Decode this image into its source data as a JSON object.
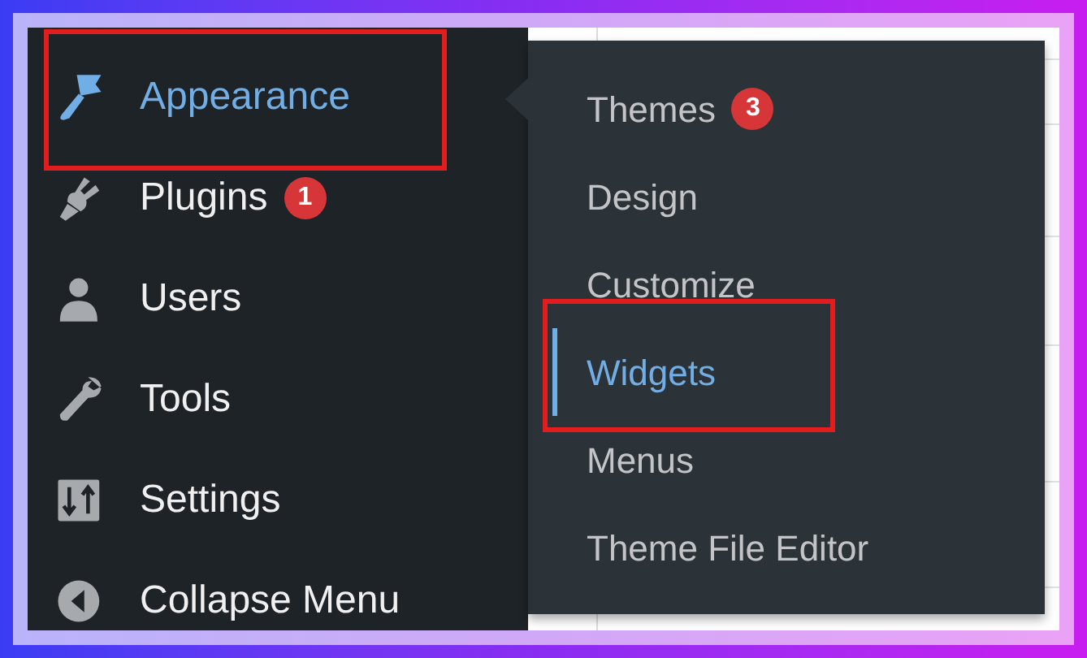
{
  "menu": {
    "items": [
      {
        "label": "Appearance",
        "kind": "brush",
        "current": true,
        "highlighted": true
      },
      {
        "label": "Plugins",
        "kind": "plug",
        "badge": "1",
        "current": false,
        "highlighted": false
      },
      {
        "label": "Users",
        "kind": "user",
        "current": false,
        "highlighted": false
      },
      {
        "label": "Tools",
        "kind": "wrench",
        "current": false,
        "highlighted": false
      },
      {
        "label": "Settings",
        "kind": "sliders",
        "current": false,
        "highlighted": false
      },
      {
        "label": "Collapse Menu",
        "kind": "collapse",
        "current": false,
        "highlighted": false
      }
    ]
  },
  "submenu": {
    "items": [
      {
        "label": "Themes",
        "badge": "3",
        "selected": false,
        "highlighted": false
      },
      {
        "label": "Design",
        "selected": false,
        "highlighted": false
      },
      {
        "label": "Customize",
        "selected": false,
        "highlighted": false
      },
      {
        "label": "Widgets",
        "selected": true,
        "highlighted": true
      },
      {
        "label": "Menus",
        "selected": false,
        "highlighted": false
      },
      {
        "label": "Theme File Editor",
        "selected": false,
        "highlighted": false
      }
    ]
  }
}
